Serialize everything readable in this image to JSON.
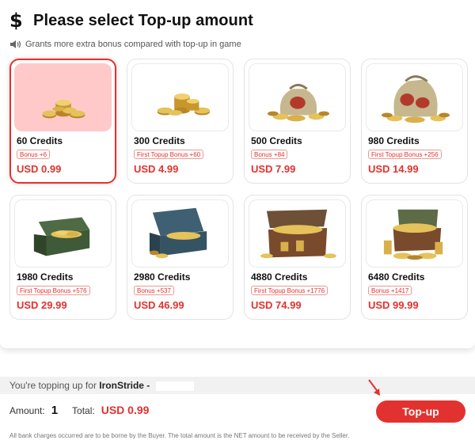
{
  "header": {
    "title": "Please select Top-up amount",
    "icon": "dollar-icon"
  },
  "notice": {
    "text": "Grants more extra bonus compared with top-up in game",
    "icon": "speaker-icon"
  },
  "packages": [
    {
      "credits": "60 Credits",
      "bonus": "Bonus +6",
      "price": "USD 0.99",
      "selected": true,
      "image": "small-coin-pile"
    },
    {
      "credits": "300 Credits",
      "bonus": "First Topup Bonus +60",
      "price": "USD 4.99",
      "selected": false,
      "image": "coin-pile"
    },
    {
      "credits": "500 Credits",
      "bonus": "Bonus +84",
      "price": "USD 7.99",
      "selected": false,
      "image": "coin-sack"
    },
    {
      "credits": "980 Credits",
      "bonus": "First Topup Bonus +256",
      "price": "USD 14.99",
      "selected": false,
      "image": "large-coin-sack"
    },
    {
      "credits": "1980 Credits",
      "bonus": "First Topup Bonus +576",
      "price": "USD 29.99",
      "selected": false,
      "image": "green-chest"
    },
    {
      "credits": "2980 Credits",
      "bonus": "Bonus +537",
      "price": "USD 46.99",
      "selected": false,
      "image": "blue-chest"
    },
    {
      "credits": "4880 Credits",
      "bonus": "First Topup Bonus +1776",
      "price": "USD 74.99",
      "selected": false,
      "image": "wooden-chest"
    },
    {
      "credits": "6480 Credits",
      "bonus": "Bonus +1417",
      "price": "USD 99.99",
      "selected": false,
      "image": "treasure-chest"
    }
  ],
  "summary": {
    "topping_prefix": "You're topping up for",
    "player_name": "IronStride -",
    "amount_label": "Amount:",
    "amount_value": "1",
    "total_label": "Total:",
    "total_value": "USD 0.99",
    "topup_button": "Top-up"
  },
  "footer": "All bank charges occurred are to be borne by the Buyer. The total amount is the NET amount to be received by the Seller.",
  "colors": {
    "accent": "#e2322f",
    "selected_bg": "#ffc9c9",
    "gold": "#d4a93a"
  }
}
